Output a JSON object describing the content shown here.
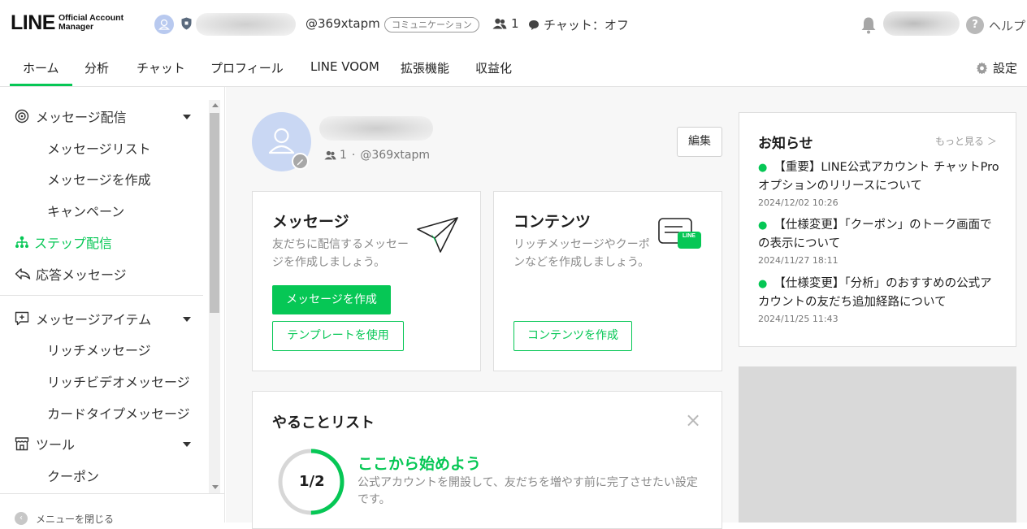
{
  "header": {
    "logo_main": "LINE",
    "logo_sub_1": "Official Account",
    "logo_sub_2": "Manager",
    "account_id": "@369xtapm",
    "plan_badge": "コミュニケーション",
    "friend_count": "1",
    "chat_status": "チャット：オフ",
    "help_label": "ヘルプ",
    "help_icon_glyph": "?"
  },
  "nav": {
    "tabs": [
      {
        "label": "ホーム"
      },
      {
        "label": "分析"
      },
      {
        "label": "チャット"
      },
      {
        "label": "プロフィール"
      },
      {
        "label": "LINE VOOM"
      },
      {
        "label": "拡張機能"
      },
      {
        "label": "収益化"
      }
    ],
    "settings_label": "設定"
  },
  "sidebar": {
    "groups": [
      {
        "label": "メッセージ配信",
        "icon": "broadcast-icon"
      },
      {
        "label": "メッセージアイテム",
        "icon": "message-item-icon"
      },
      {
        "label": "ツール",
        "icon": "store-icon"
      }
    ],
    "items": {
      "message_list": "メッセージリスト",
      "create_message": "メッセージを作成",
      "campaign": "キャンペーン",
      "step_delivery": "ステップ配信",
      "auto_response": "応答メッセージ",
      "rich_message": "リッチメッセージ",
      "rich_video": "リッチビデオメッセージ",
      "card_type": "カードタイプメッセージ",
      "coupon": "クーポン"
    },
    "collapse_label": "メニューを閉じる",
    "accent_color": "#06c755"
  },
  "profile": {
    "friend_count": "1",
    "separator": "·",
    "account_id": "@369xtapm",
    "edit_label": "編集"
  },
  "cards": {
    "message": {
      "title": "メッセージ",
      "desc": "友だちに配信するメッセージを作成しましょう。",
      "primary_button": "メッセージを作成",
      "secondary_button": "テンプレートを使用"
    },
    "contents": {
      "title": "コンテンツ",
      "desc": "リッチメッセージやクーポンなどを作成しましょう。",
      "button": "コンテンツを作成",
      "icon_badge": "LINE"
    }
  },
  "todo": {
    "title": "やることリスト",
    "progress_label": "1/2",
    "progress_fraction": 0.5,
    "heading": "ここから始めよう",
    "desc": "公式アカウントを開設して、友だちを増やす前に完了させたい設定です。"
  },
  "news": {
    "title": "お知らせ",
    "more": "もっと見る ＞",
    "items": [
      {
        "text": "【重要】LINE公式アカウント チャットProオプションのリリースについて",
        "date": "2024/12/02 10:26"
      },
      {
        "text": "【仕様変更】「クーポン」のトーク画面での表示について",
        "date": "2024/11/27 18:11"
      },
      {
        "text": "【仕様変更】「分析」のおすすめの公式アカウントの友だち追加経路について",
        "date": "2024/11/25 11:43"
      }
    ]
  },
  "colors": {
    "brand_green": "#06c755",
    "page_bg": "#f7f7f7"
  }
}
